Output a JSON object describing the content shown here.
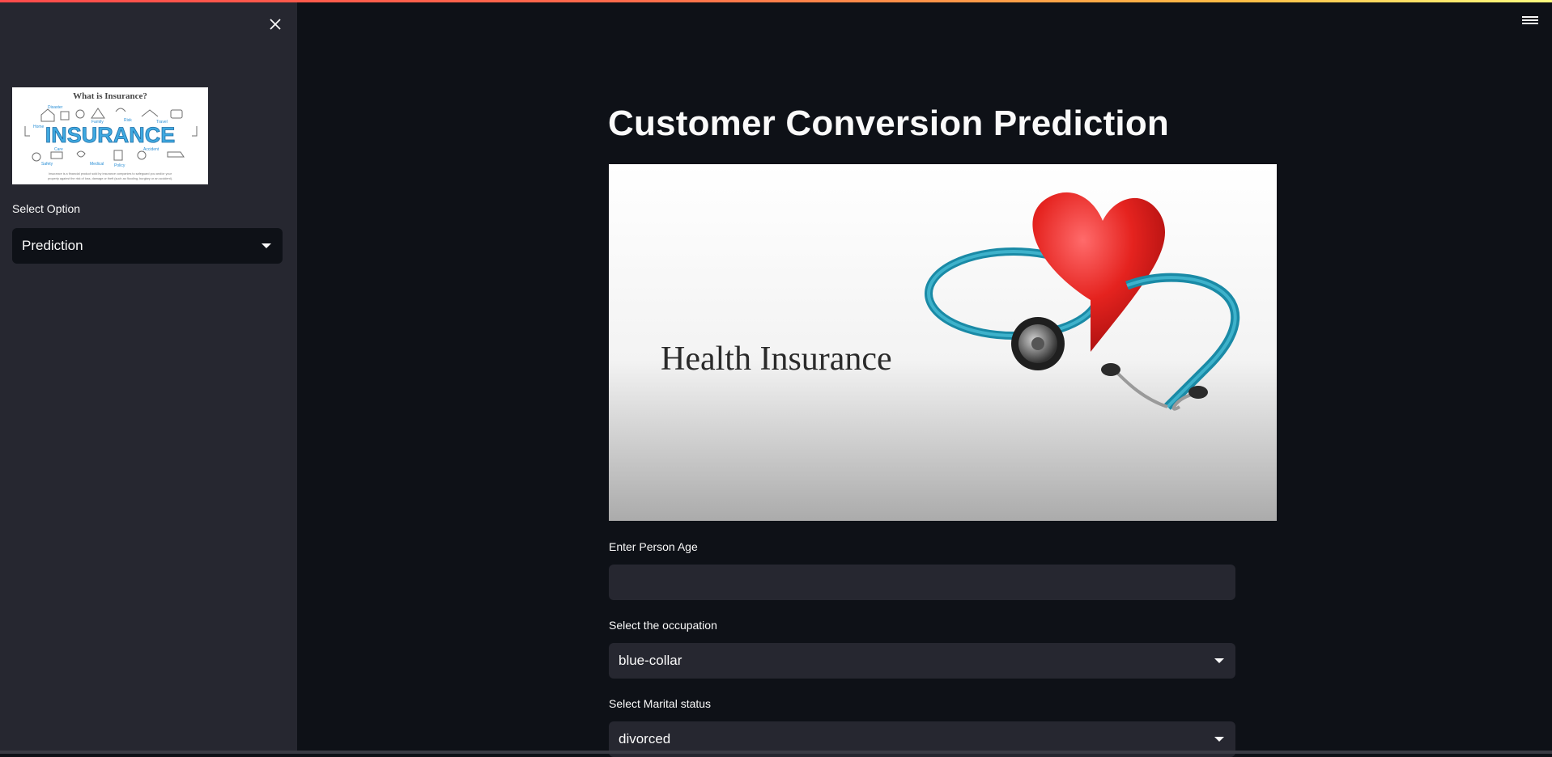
{
  "sidebar": {
    "logo": {
      "heading": "What is Insurance?",
      "word": "INSURANCE",
      "tags": [
        "Disaster",
        "Home",
        "Family",
        "Risk",
        "Travel",
        "Care",
        "Accident",
        "Safety",
        "Medical",
        "Policy"
      ],
      "caption_line1": "Insurance is a financial product sold by insurance companies to safeguard you and/or your",
      "caption_line2": "property against the risk of loss, damage or theft (such as flooding, burglary or an accident)."
    },
    "select_label": "Select Option",
    "select_value": "Prediction"
  },
  "main": {
    "title": "Customer Conversion Prediction",
    "banner_text": "Health Insurance",
    "age_label": "Enter Person Age",
    "age_value": "",
    "occupation_label": "Select the occupation",
    "occupation_value": "blue-collar",
    "marital_label": "Select Marital status",
    "marital_value": "divorced"
  },
  "colors": {
    "background": "#0e1117",
    "sidebar": "#262730",
    "input": "#262730",
    "accent": "#ff4b4b",
    "text": "#fafafa"
  },
  "icons": {
    "close": "close-icon",
    "menu": "hamburger-menu-icon",
    "dropdown": "chevron-down-icon"
  }
}
